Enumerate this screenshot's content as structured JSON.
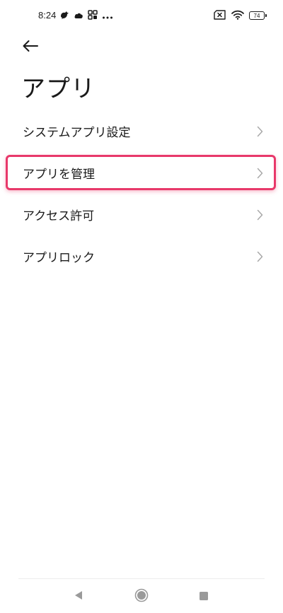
{
  "status_bar": {
    "time": "8:24",
    "battery_level": "74",
    "left_icons": [
      "bird-icon",
      "cloud-icon",
      "grid-icon",
      "more-icon"
    ],
    "right_icons": [
      "sim-x-icon",
      "wifi-icon",
      "battery-icon"
    ]
  },
  "header": {
    "back_icon": "arrow-left-icon",
    "title": "アプリ"
  },
  "settings": {
    "items": [
      {
        "label": "システムアプリ設定",
        "icon": "chevron-right-icon"
      },
      {
        "label": "アプリを管理",
        "icon": "chevron-right-icon",
        "highlighted": true
      },
      {
        "label": "アクセス許可",
        "icon": "chevron-right-icon"
      },
      {
        "label": "アプリロック",
        "icon": "chevron-right-icon"
      }
    ]
  },
  "highlight_color": "#e8386a",
  "nav_bar": {
    "buttons": [
      "back-triangle-icon",
      "home-circle-icon",
      "recents-square-icon"
    ]
  }
}
